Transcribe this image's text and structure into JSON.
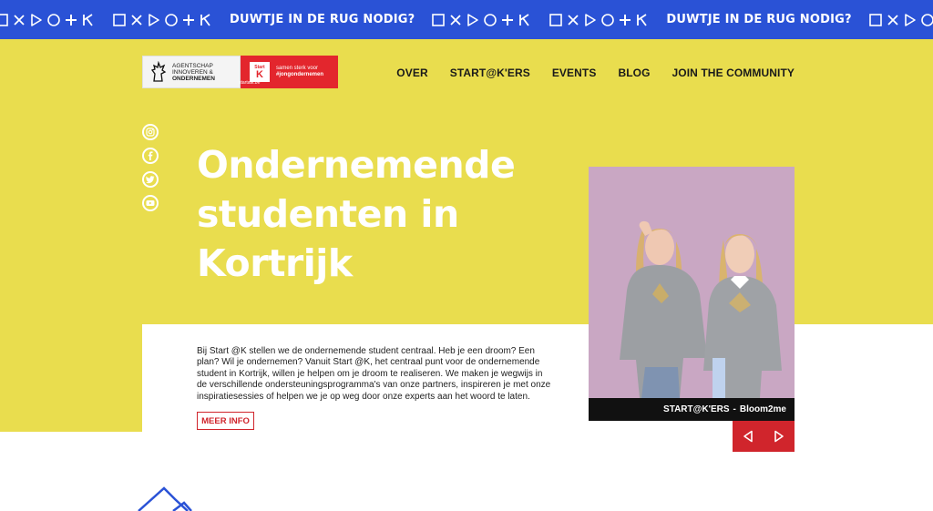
{
  "ticker": {
    "message": "DUWTJE IN DE RUG NODIG?",
    "symbols": [
      "square",
      "cross",
      "triangle",
      "circle",
      "plus",
      "k"
    ]
  },
  "logo": {
    "agency_line1": "AGENTSCHAP",
    "agency_line2": "INNOVEREN &",
    "agency_line3": "ONDERNEMEN",
    "badge_top": "Start",
    "badge_letter": "K",
    "badge_sub": "startatk.be",
    "slogan_line1": "samen sterk voor",
    "slogan_line2": "#jongondernemen"
  },
  "nav": {
    "items": [
      {
        "label": "OVER"
      },
      {
        "label": "START@K'ERS"
      },
      {
        "label": "EVENTS"
      },
      {
        "label": "BLOG"
      },
      {
        "label": "JOIN THE COMMUNITY"
      }
    ]
  },
  "social": [
    "instagram-icon",
    "facebook-icon",
    "twitter-icon",
    "youtube-icon"
  ],
  "hero": {
    "title_line1": "Ondernemende",
    "title_line2": "studenten in",
    "title_line3": "Kortrijk"
  },
  "intro": {
    "text": "Bij Start @K stellen we de ondernemende student centraal. Heb je een droom? Een plan? Wil je ondernemen? Vanuit Start @K, het centraal punt voor de ondernemende student in Kortrijk, willen je helpen om je droom te realiseren. We maken je wegwijs in de verschillende ondersteuningsprogramma's van onze partners, inspireren je met onze inspiratiesessies of helpen we je op weg door onze experts aan het woord te laten.",
    "button": "MEER INFO"
  },
  "card": {
    "category": "START@K'ERS",
    "separator": "-",
    "name": "Bloom2me"
  },
  "colors": {
    "ticker_blue": "#2a52d6",
    "hero_yellow": "#e9dd4e",
    "accent_red": "#d0252c"
  }
}
